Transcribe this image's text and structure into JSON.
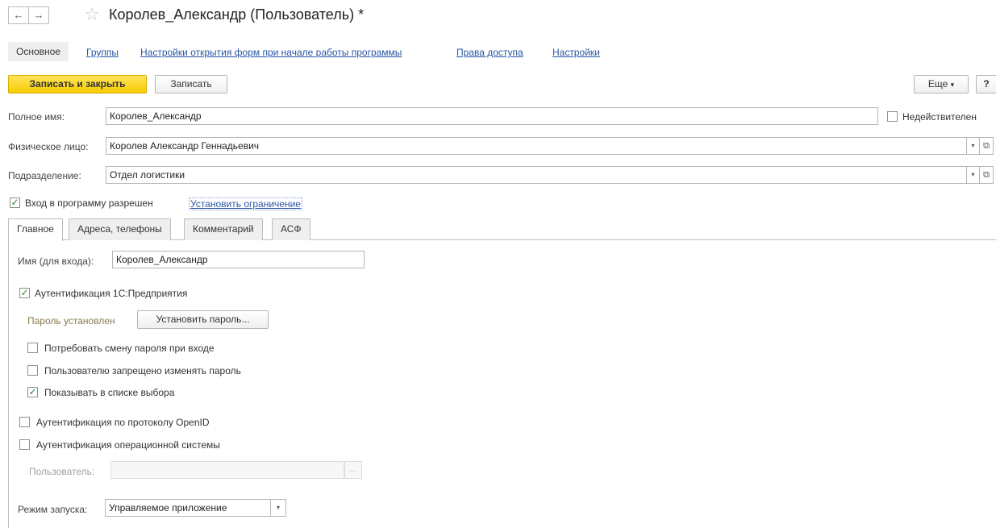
{
  "window": {
    "title": "Королев_Александр (Пользователь) *",
    "back_icon": "←",
    "forward_icon": "→",
    "star_icon": "☆"
  },
  "nav": {
    "main": "Основное",
    "groups": "Группы",
    "startup_forms": "Настройки открытия форм при начале работы программы",
    "access_rights": "Права доступа",
    "settings": "Настройки"
  },
  "toolbar": {
    "save_close": "Записать и закрыть",
    "save": "Записать",
    "more": "Еще",
    "more_arrow": "▾",
    "help": "?"
  },
  "form": {
    "full_name_label": "Полное имя:",
    "full_name_value": "Королев_Александр",
    "invalid_label": "Недействителен",
    "person_label": "Физическое лицо:",
    "person_value": "Королев Александр Геннадьевич",
    "department_label": "Подразделение:",
    "department_value": "Отдел логистики",
    "login_allowed_label": "Вход в программу разрешен",
    "set_restriction_link": "Установить ограничение",
    "dropdown_arrow": "▾",
    "open_glyph": "⧉",
    "check_glyph": "✓"
  },
  "tabs": {
    "main": "Главное",
    "addresses": "Адреса, телефоны",
    "comment": "Комментарий",
    "asf": "АСФ"
  },
  "auth": {
    "login_name_label": "Имя (для входа):",
    "login_name_value": "Королев_Александр",
    "enterprise_auth": "Аутентификация 1С:Предприятия",
    "password_status": "Пароль установлен",
    "set_password": "Установить пароль...",
    "require_change": "Потребовать смену пароля при входе",
    "forbid_change": "Пользователю запрещено изменять пароль",
    "show_in_list": "Показывать в списке выбора",
    "openid_auth": "Аутентификация по протоколу OpenID",
    "os_auth": "Аутентификация операционной системы",
    "os_user_label": "Пользователь:",
    "os_user_value": "",
    "ellipsis": "...",
    "launch_mode_label": "Режим запуска:",
    "launch_mode_value": "Управляемое приложение"
  }
}
